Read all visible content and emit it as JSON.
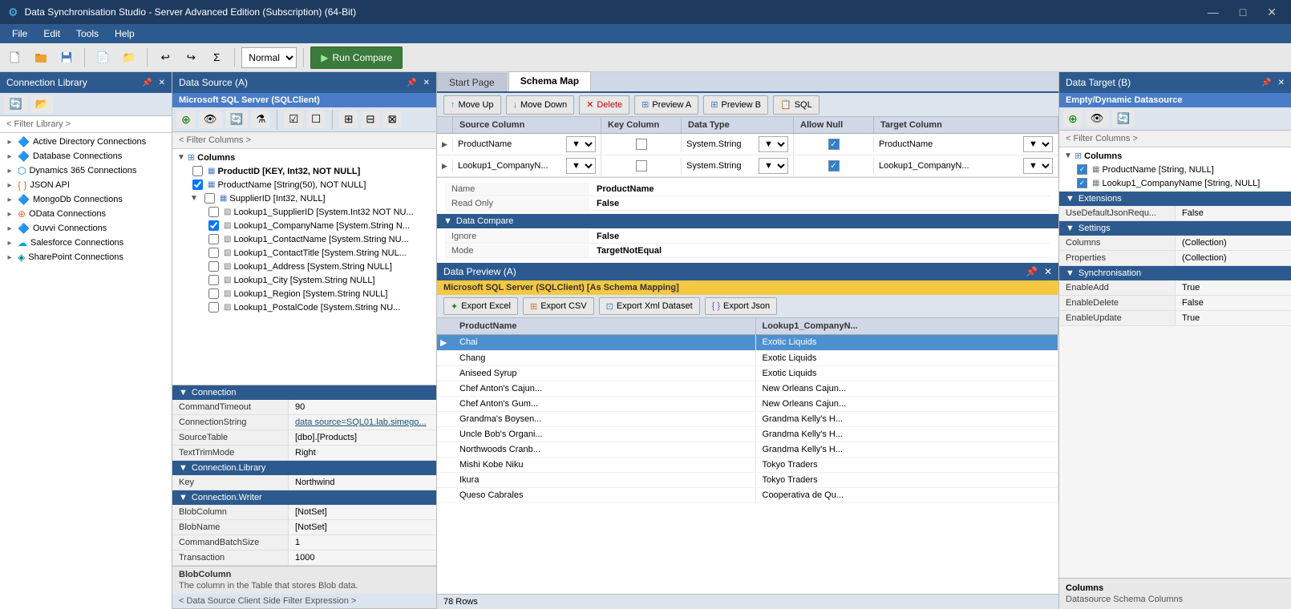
{
  "titlebar": {
    "title": "Data Synchronisation Studio - Server Advanced Edition (Subscription) (64-Bit)",
    "min_btn": "—",
    "max_btn": "□",
    "close_btn": "✕"
  },
  "menubar": {
    "items": [
      "File",
      "Edit",
      "Tools",
      "Help"
    ]
  },
  "toolbar": {
    "mode_options": [
      "Normal"
    ],
    "mode_selected": "Normal",
    "run_btn": "Run Compare"
  },
  "connection_library": {
    "title": "Connection Library",
    "filter_label": "< Filter Library >",
    "tree_items": [
      {
        "label": "Active Directory Connections",
        "icon": "▸",
        "type": "group"
      },
      {
        "label": "Database Connections",
        "icon": "▸",
        "type": "group"
      },
      {
        "label": "Dynamics 365 Connections",
        "icon": "▸",
        "type": "group"
      },
      {
        "label": "JSON API",
        "icon": "▸",
        "type": "group"
      },
      {
        "label": "MongoDb Connections",
        "icon": "▸",
        "type": "group"
      },
      {
        "label": "OData Connections",
        "icon": "▸",
        "type": "group"
      },
      {
        "label": "Ouvvi Connections",
        "icon": "▸",
        "type": "group"
      },
      {
        "label": "Salesforce Connections",
        "icon": "▸",
        "type": "group"
      },
      {
        "label": "SharePoint Connections",
        "icon": "▸",
        "type": "group"
      }
    ]
  },
  "datasource": {
    "title": "Data Source (A)",
    "connection_label": "Microsoft SQL Server (SQLClient)",
    "filter_label": "< Filter Columns >",
    "tree": {
      "root": "Columns",
      "nodes": [
        {
          "label": "ProductID [KEY, Int32, NOT NULL]",
          "bold": true,
          "checked": false
        },
        {
          "label": "ProductName [String(50), NOT NULL]",
          "bold": false,
          "checked": true
        },
        {
          "label": "SupplierID [Int32, NULL]",
          "bold": false,
          "checked": false,
          "children": [
            {
              "label": "Lookup1_SupplierID [System.Int32 NOT NU..."
            },
            {
              "label": "Lookup1_CompanyName [System.String N..."
            },
            {
              "label": "Lookup1_ContactName [System.String NU..."
            },
            {
              "label": "Lookup1_ContactTitle [System.String NUL..."
            },
            {
              "label": "Lookup1_Address [System.String NULL]"
            },
            {
              "label": "Lookup1_City [System.String NULL]"
            },
            {
              "label": "Lookup1_Region [System.String NULL]"
            },
            {
              "label": "Lookup1_PostalCode [System.String NU..."
            }
          ]
        }
      ]
    },
    "props": {
      "connection": {
        "label": "Connection",
        "rows": [
          {
            "key": "CommandTimeout",
            "val": "90"
          },
          {
            "key": "ConnectionString",
            "val": "data source=SQL01.lab.simego..."
          },
          {
            "key": "SourceTable",
            "val": "[dbo].[Products]"
          },
          {
            "key": "TextTrimMode",
            "val": "Right"
          }
        ]
      },
      "connection_library": {
        "label": "Connection.Library",
        "rows": [
          {
            "key": "Key",
            "val": "Northwind"
          }
        ]
      },
      "connection_writer": {
        "label": "Connection.Writer",
        "rows": [
          {
            "key": "BlobColumn",
            "val": "[NotSet]"
          },
          {
            "key": "BlobName",
            "val": "[NotSet]"
          },
          {
            "key": "CommandBatchSize",
            "val": "1"
          },
          {
            "key": "Transaction",
            "val": "1000"
          }
        ]
      }
    },
    "footer": {
      "label": "BlobColumn",
      "desc": "The column in the Table that stores Blob data."
    },
    "filter_expr": "< Data Source Client Side Filter Expression >"
  },
  "schema_map": {
    "tabs": [
      "Start Page",
      "Schema Map"
    ],
    "active_tab": "Schema Map",
    "toolbar": {
      "move_up": "Move Up",
      "move_down": "Move Down",
      "delete": "Delete",
      "preview_a": "Preview A",
      "preview_b": "Preview B",
      "sql": "SQL"
    },
    "columns": {
      "headers": [
        "",
        "Source Column",
        "Key Column",
        "Data Type",
        "Allow Null",
        "Target Column"
      ],
      "rows": [
        {
          "expand": "▶",
          "source": "ProductName",
          "key_checked": false,
          "data_type": "System.String",
          "allow_null": true,
          "target": "ProductName"
        },
        {
          "expand": "▶",
          "source": "Lookup1_CompanyN...",
          "key_checked": false,
          "data_type": "System.String",
          "allow_null": true,
          "target": "Lookup1_CompanyN..."
        }
      ]
    },
    "properties": {
      "rows": [
        {
          "key": "Name",
          "val": "ProductName"
        },
        {
          "key": "Read Only",
          "val": "False"
        }
      ],
      "data_compare": {
        "label": "Data Compare",
        "rows": [
          {
            "key": "Ignore",
            "val": "False"
          },
          {
            "key": "Mode",
            "val": "TargetNotEqual"
          }
        ]
      }
    }
  },
  "data_preview": {
    "title": "Data Preview (A)",
    "source_label": "Microsoft SQL Server (SQLClient) [As Schema Mapping]",
    "export_buttons": [
      "Export Excel",
      "Export CSV",
      "Export Xml Dataset",
      "Export Json"
    ],
    "columns": [
      "ProductName",
      "Lookup1_CompanyN..."
    ],
    "rows": [
      {
        "col1": "Chai",
        "col2": "Exotic Liquids",
        "selected": true
      },
      {
        "col1": "Chang",
        "col2": "Exotic Liquids",
        "selected": false
      },
      {
        "col1": "Aniseed Syrup",
        "col2": "Exotic Liquids",
        "selected": false
      },
      {
        "col1": "Chef Anton's Cajun...",
        "col2": "New Orleans Cajun...",
        "selected": false
      },
      {
        "col1": "Chef Anton's Gum...",
        "col2": "New Orleans Cajun...",
        "selected": false
      },
      {
        "col1": "Grandma's Boysen...",
        "col2": "Grandma Kelly's H...",
        "selected": false
      },
      {
        "col1": "Uncle Bob's Organi...",
        "col2": "Grandma Kelly's H...",
        "selected": false
      },
      {
        "col1": "Northwoods Cranb...",
        "col2": "Grandma Kelly's H...",
        "selected": false
      },
      {
        "col1": "Mishi Kobe Niku",
        "col2": "Tokyo Traders",
        "selected": false
      },
      {
        "col1": "Ikura",
        "col2": "Tokyo Traders",
        "selected": false
      },
      {
        "col1": "Queso Cabrales",
        "col2": "Cooperativa de Qu...",
        "selected": false
      }
    ],
    "footer": "78 Rows"
  },
  "data_target": {
    "title": "Data Target (B)",
    "connection_label": "Empty/Dynamic Datasource",
    "filter_label": "< Filter Columns >",
    "tree": {
      "root": "Columns",
      "nodes": [
        {
          "label": "ProductName [String, NULL]",
          "checked": true
        },
        {
          "label": "Lookup1_CompanyName [String, NULL]",
          "checked": true
        }
      ]
    },
    "props": {
      "extensions": {
        "label": "Extensions",
        "rows": [
          {
            "key": "UseDefaultJsonRequ...",
            "val": "False"
          }
        ]
      },
      "settings": {
        "label": "Settings",
        "rows": [
          {
            "key": "Columns",
            "val": "(Collection)"
          },
          {
            "key": "Properties",
            "val": "(Collection)"
          }
        ]
      },
      "synchronisation": {
        "label": "Synchronisation",
        "rows": [
          {
            "key": "EnableAdd",
            "val": "True"
          },
          {
            "key": "EnableDelete",
            "val": "False"
          },
          {
            "key": "EnableUpdate",
            "val": "True"
          }
        ]
      }
    },
    "footer": {
      "label": "Columns",
      "desc": "Datasource Schema Columns"
    }
  }
}
